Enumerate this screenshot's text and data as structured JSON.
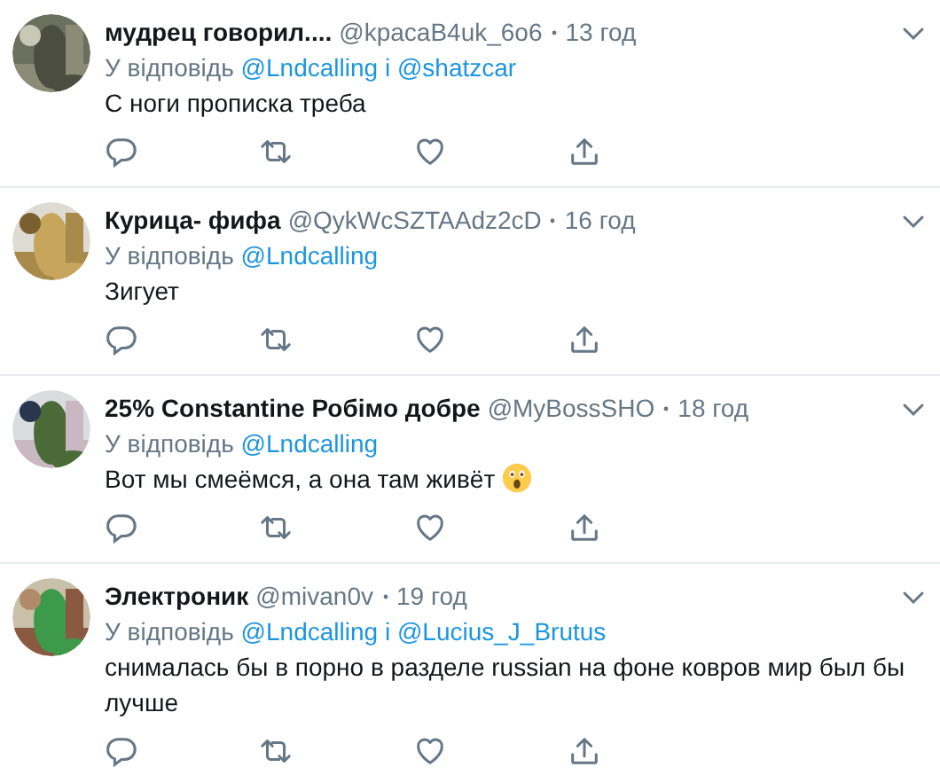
{
  "tweets": [
    {
      "name": "мудрец говорил....",
      "handle": "@kpacaB4uk_6o6",
      "time": "13 год",
      "reply_prefix": "У відповідь",
      "mentions": [
        "@Lndcalling",
        "@shatzcar"
      ],
      "joiner": "і",
      "text": "С ноги прописка треба",
      "avatar": {
        "kind": "picture"
      }
    },
    {
      "name": "Курица- фифа",
      "handle": "@QykWcSZTAAdz2cD",
      "time": "16 год",
      "reply_prefix": "У відповідь",
      "mentions": [
        "@Lndcalling"
      ],
      "text": "Зигует",
      "avatar": {
        "kind": "picture"
      }
    },
    {
      "name": "25% Constantine Робімо добре",
      "handle": "@MyBossSHO",
      "time": "18 год",
      "reply_prefix": "У відповідь",
      "mentions": [
        "@Lndcalling"
      ],
      "text": "Вот мы смеёмся, а она там живёт",
      "emoji": true,
      "avatar": {
        "kind": "picture"
      }
    },
    {
      "name": "Электроник",
      "handle": "@mivan0v",
      "time": "19 год",
      "reply_prefix": "У відповідь",
      "mentions": [
        "@Lndcalling",
        "@Lucius_J_Brutus"
      ],
      "joiner": "і",
      "text": "снималась бы в порно в разделе russian на фоне ковров мир был бы лучше",
      "avatar": {
        "kind": "picture"
      }
    }
  ]
}
